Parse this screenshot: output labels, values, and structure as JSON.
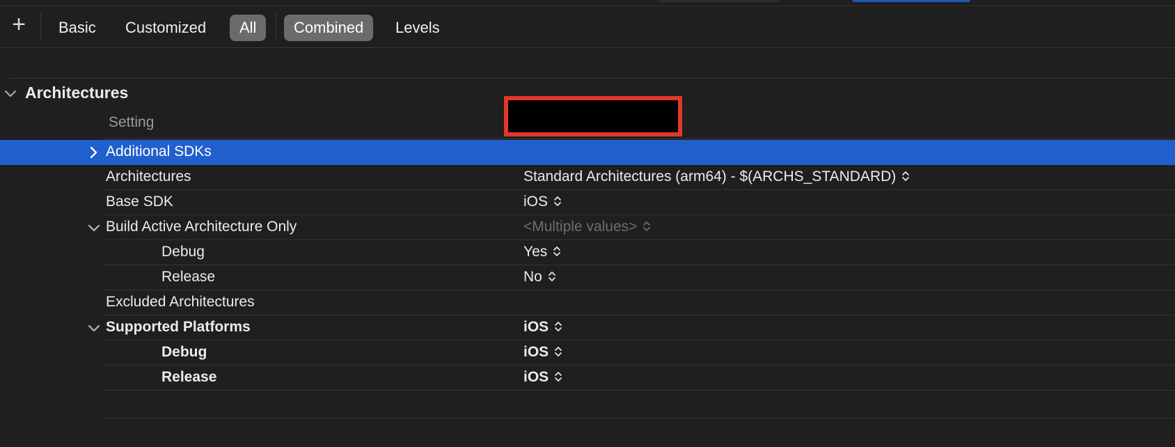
{
  "toolbar": {
    "add_label": "+",
    "buttons": [
      {
        "label": "Basic",
        "selected": false
      },
      {
        "label": "Customized",
        "selected": false
      },
      {
        "label": "All",
        "selected": true
      },
      {
        "label": "Combined",
        "selected": true
      },
      {
        "label": "Levels",
        "selected": false
      }
    ]
  },
  "section": {
    "title": "Architectures",
    "column_header": "Setting",
    "redacted_color": "#e0382a"
  },
  "rows": [
    {
      "label": "Additional SDKs",
      "value": "",
      "selected": true,
      "disclosure": "collapsed"
    },
    {
      "label": "Architectures",
      "value": "Standard Architectures (arm64)  -  $(ARCHS_STANDARD)"
    },
    {
      "label": "Base SDK",
      "value": "iOS"
    },
    {
      "label": "Build Active Architecture Only",
      "value": "<Multiple values>",
      "disclosure": "expanded"
    },
    {
      "label": "Debug",
      "value": "Yes"
    },
    {
      "label": "Release",
      "value": "No"
    },
    {
      "label": "Excluded Architectures",
      "value": ""
    },
    {
      "label": "Supported Platforms",
      "value": "iOS",
      "disclosure": "expanded"
    },
    {
      "label": "Debug",
      "value": "iOS"
    },
    {
      "label": "Release",
      "value": "iOS"
    }
  ],
  "colors": {
    "background": "#1f1f1f",
    "selection": "#2160cc",
    "selected_button": "#6b6b6b"
  }
}
